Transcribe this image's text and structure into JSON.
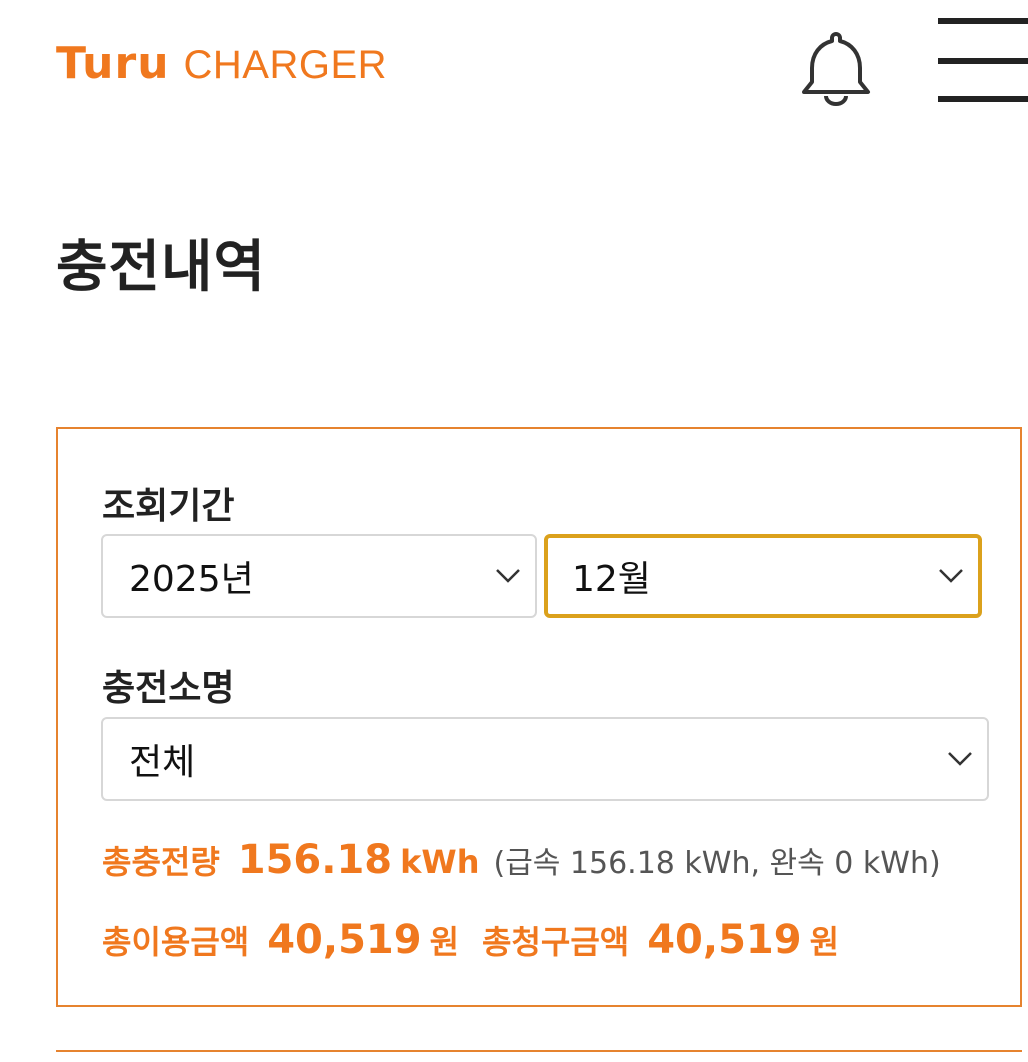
{
  "header": {
    "logo_brand": "Turu",
    "logo_sub": "CHARGER",
    "notification_icon": "bell-icon",
    "menu_icon": "hamburger-menu-icon"
  },
  "page": {
    "title": "충전내역"
  },
  "filter": {
    "period_label": "조회기간",
    "year_select": {
      "value": "2025년"
    },
    "month_select": {
      "value": "12월"
    },
    "station_label": "충전소명",
    "station_select": {
      "value": "전체"
    }
  },
  "summary": {
    "total_charge_label": "총충전량",
    "total_charge_value": "156.18",
    "total_charge_unit": "kWh",
    "total_charge_detail": "(급속 156.18 kWh, 완속 0 kWh)",
    "total_usage_label": "총이용금액",
    "total_usage_value": "40,519",
    "total_usage_unit": "원",
    "total_billed_label": "총청구금액",
    "total_billed_value": "40,519",
    "total_billed_unit": "원"
  },
  "colors": {
    "accent": "#f0781e",
    "focus_border": "#dba11c",
    "box_border": "#e6832f"
  }
}
